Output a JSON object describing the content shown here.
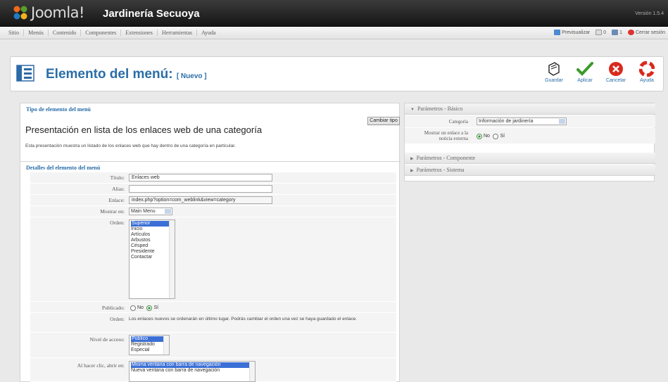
{
  "header": {
    "brand": "Joomla!",
    "site_name": "Jardinería Secuoya",
    "version": "Versión 1.5.4"
  },
  "menubar": {
    "items": [
      "Sitio",
      "Menús",
      "Contenido",
      "Componentes",
      "Extensiones",
      "Herramientas",
      "Ayuda"
    ],
    "status": {
      "preview": "Previsualizar",
      "messages": "0",
      "users": "1",
      "logout": "Cerrar sesión"
    }
  },
  "toolbar": {
    "title": "Elemento del menú:",
    "subtitle": "[ Nuevo ]",
    "buttons": {
      "save": "Guardar",
      "apply": "Aplicar",
      "cancel": "Cancelar",
      "help": "Ayuda"
    }
  },
  "type_section": {
    "legend": "Tipo de elemento del menú",
    "title": "Presentación en lista de los enlaces web de una categoría",
    "description": "Esta presentación muestra un listado de los enlaces web que hay dentro de una categoría en particular.",
    "change_button": "Cambiar tipo"
  },
  "details": {
    "legend": "Detalles del elemento del menú",
    "title_label": "Título:",
    "title_value": "Enlaces web",
    "alias_label": "Alias:",
    "alias_value": "",
    "link_label": "Enlace:",
    "link_value": "index.php?option=com_weblink&view=category",
    "menu_label": "Mostrar en:",
    "menu_value": "Main Menu",
    "parent_label": "Orden:",
    "parent_options": [
      "Superior",
      "Inicio",
      "Artículos",
      "Arbustos",
      "Césped",
      "Presidente",
      "Contactar"
    ],
    "parent_selected": "Superior",
    "published_label": "Publicado:",
    "published_no": "No",
    "published_yes": "Sí",
    "order_label": "Orden:",
    "order_note": "Los enlaces nuevos se ordenarán en último lugar. Podrás cambiar el orden una vez se haya guardado el enlace.",
    "access_label": "Nivel de acceso:",
    "access_options": [
      "Público",
      "Registrado",
      "Especial"
    ],
    "access_selected": "Público",
    "onclick_label": "Al hacer clic, abrir en:",
    "onclick_options": [
      "Misma ventana con barra de navegación",
      "Nueva ventana con barra de navegación"
    ],
    "onclick_selected": "Misma ventana con barra de navegación"
  },
  "params": {
    "basic_title": "Parámetros - Básico",
    "category_label": "Categoría",
    "category_value": "Información de jardinería",
    "external_label_1": "Mostrar un enlace a la",
    "external_label_2": "noticia externa",
    "external_no": "No",
    "external_yes": "Sí",
    "component_title": "Parámetros - Componente",
    "system_title": "Parámetros - Sistema"
  },
  "colors": {
    "header_bg": "#1f1f1f",
    "title_blue": "#2a6da8",
    "selection": "#3b6fd6"
  }
}
